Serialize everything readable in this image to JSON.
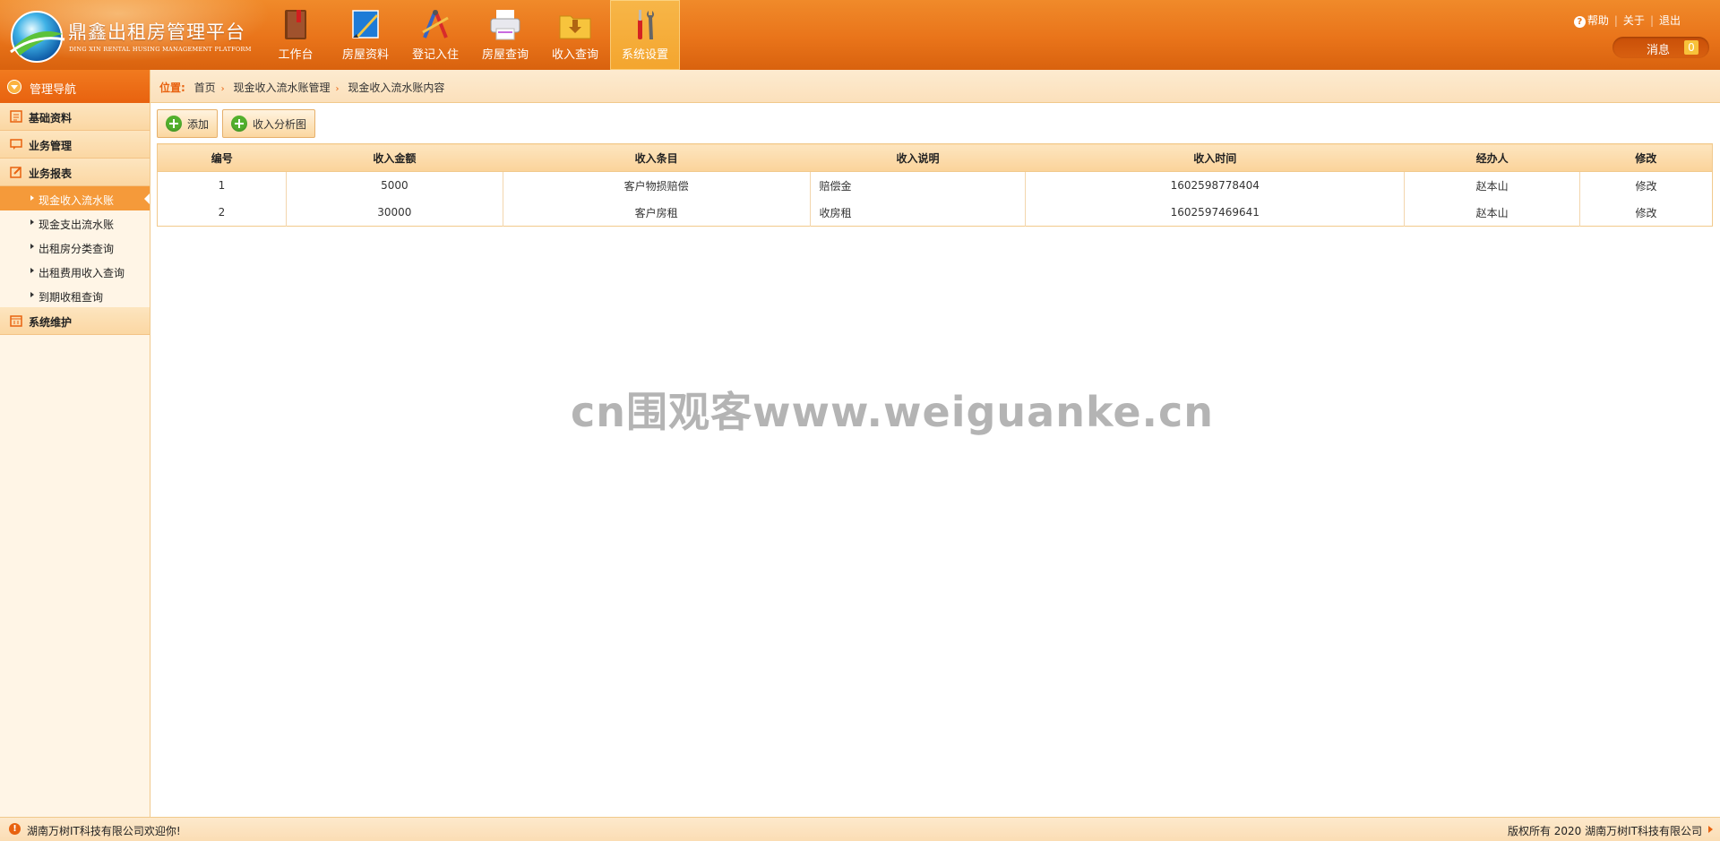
{
  "header": {
    "title": "鼎鑫出租房管理平台",
    "subtitle": "DING XIN RENTAL HUSING MANAGEMENT PLATFORM",
    "nav": [
      {
        "label": "工作台",
        "icon": "book-icon"
      },
      {
        "label": "房屋资料",
        "icon": "ruler-icon"
      },
      {
        "label": "登记入住",
        "icon": "compass-icon"
      },
      {
        "label": "房屋查询",
        "icon": "printer-icon"
      },
      {
        "label": "收入查询",
        "icon": "download-folder-icon"
      },
      {
        "label": "系统设置",
        "icon": "tools-icon"
      }
    ],
    "links": {
      "help": "帮助",
      "about": "关于",
      "logout": "退出"
    },
    "message_label": "消息",
    "message_count": "0"
  },
  "sidebar": {
    "title": "管理导航",
    "groups": [
      {
        "label": "基础资料"
      },
      {
        "label": "业务管理"
      },
      {
        "label": "业务报表"
      },
      {
        "label": "系统维护"
      }
    ],
    "items": [
      {
        "label": "现金收入流水账"
      },
      {
        "label": "现金支出流水账"
      },
      {
        "label": "出租房分类查询"
      },
      {
        "label": "出租费用收入查询"
      },
      {
        "label": "到期收租查询"
      }
    ]
  },
  "breadcrumb": {
    "prefix": "位置:",
    "items": [
      "首页",
      "现金收入流水账管理",
      "现金收入流水账内容"
    ]
  },
  "toolbar": {
    "add": "添加",
    "chart": "收入分析图"
  },
  "table": {
    "headers": [
      "编号",
      "收入金额",
      "收入条目",
      "收入说明",
      "收入时间",
      "经办人",
      "修改"
    ],
    "rows": [
      [
        "1",
        "5000",
        "客户物损赔偿",
        "赔偿金",
        "1602598778404",
        "赵本山",
        "修改"
      ],
      [
        "2",
        "30000",
        "客户房租",
        "收房租",
        "1602597469641",
        "赵本山",
        "修改"
      ]
    ]
  },
  "watermark": "cn围观客www.weiguanke.cn",
  "footer": {
    "left": "湖南万树IT科技有限公司欢迎你!",
    "right": "版权所有 2020 湖南万树IT科技有限公司"
  },
  "colors": {
    "accent": "#e8741a",
    "active_nav": "#f4a52e",
    "panel": "#fde5bf"
  }
}
